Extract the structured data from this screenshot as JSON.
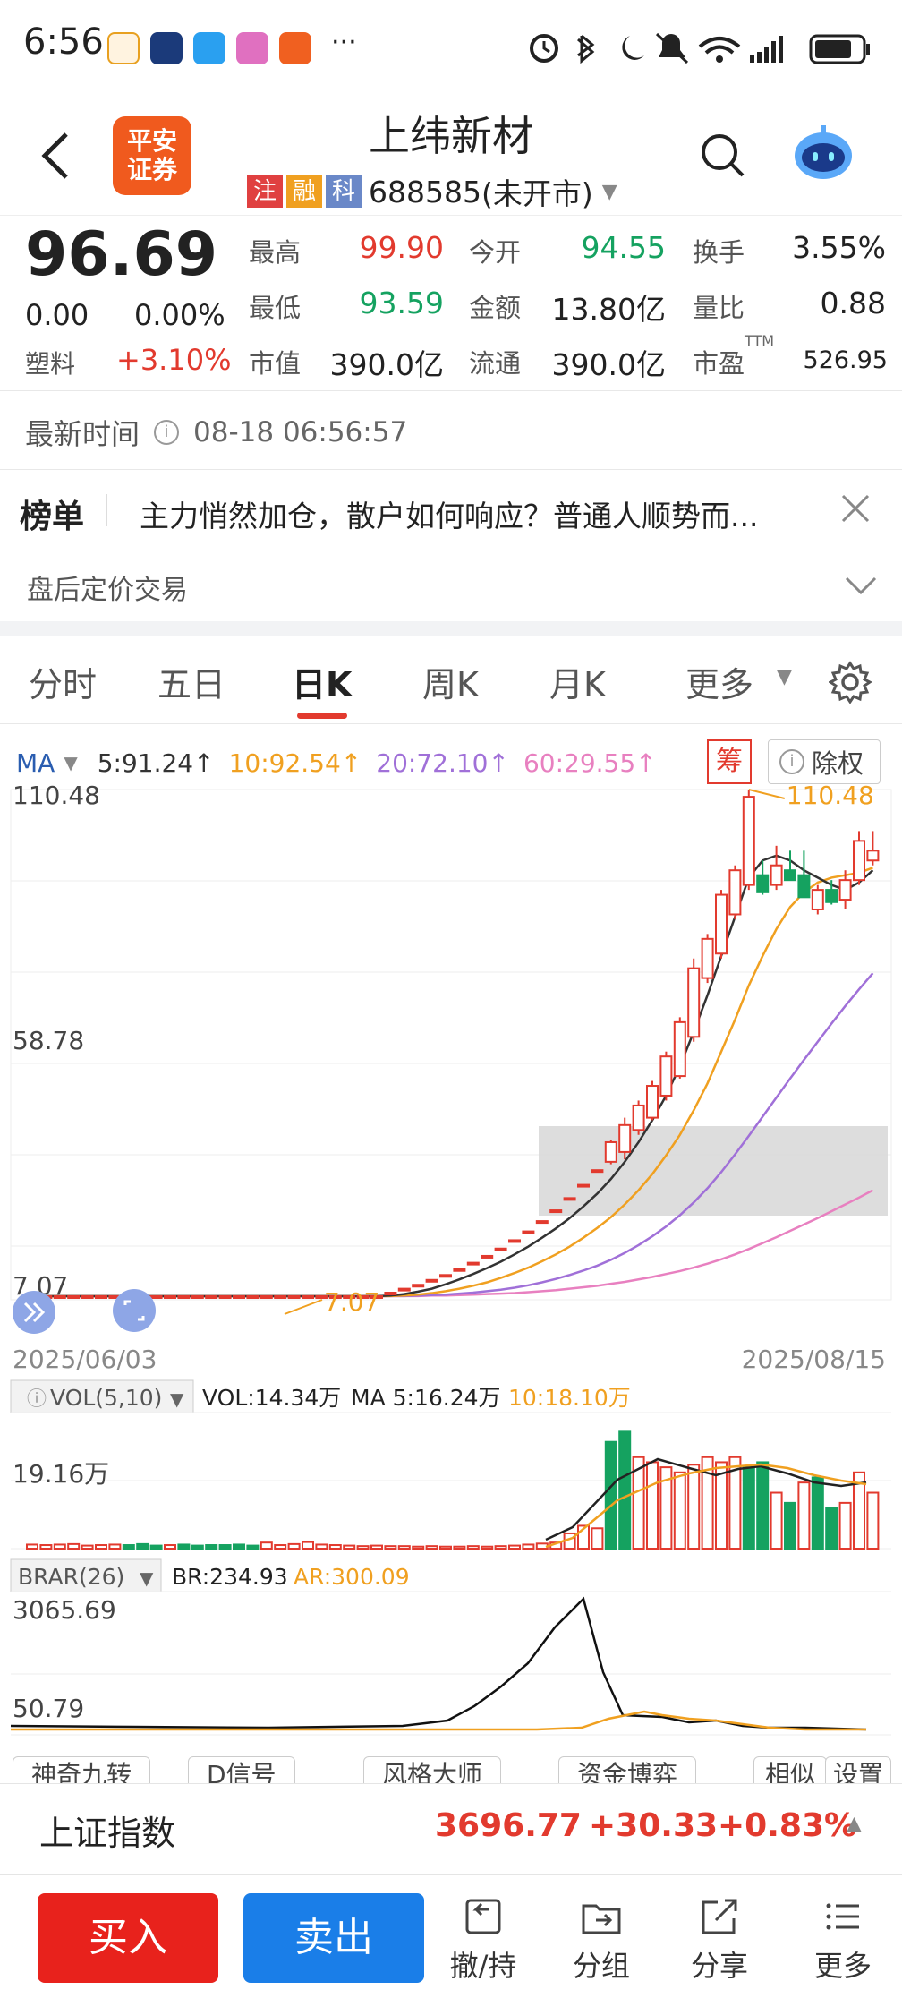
{
  "status_bar": {
    "time": "6:56"
  },
  "header": {
    "logo_line1": "平安",
    "logo_line2": "证券",
    "stock_name": "上纬新材",
    "tags": [
      "注",
      "融",
      "科"
    ],
    "code": "688585",
    "market_status": "(未开市)"
  },
  "quote": {
    "price": "96.69",
    "change": "0.00",
    "change_pct": "0.00%",
    "sector_name": "塑料",
    "sector_change": "+3.10%",
    "fields": {
      "high_label": "最高",
      "high": "99.90",
      "open_label": "今开",
      "open": "94.55",
      "turnover_label": "换手",
      "turnover": "3.55%",
      "low_label": "最低",
      "low": "93.59",
      "amount_label": "金额",
      "amount": "13.80亿",
      "volratio_label": "量比",
      "volratio": "0.88",
      "mktcap_label": "市值",
      "mktcap": "390.0亿",
      "float_label": "流通",
      "float": "390.0亿",
      "pe_label": "市盈",
      "pe_sup": "TTM",
      "pe": "526.95"
    }
  },
  "latest_time": {
    "label": "最新时间",
    "value": "08-18 06:56:57"
  },
  "ranking": {
    "label": "榜单",
    "headline": "主力悄然加仓，散户如何响应？普通人顺势而..."
  },
  "after_hours": {
    "label": "盘后定价交易"
  },
  "tabs": [
    "分时",
    "五日",
    "日K",
    "周K",
    "月K",
    "更多"
  ],
  "active_tab": "日K",
  "ma_bar": {
    "label": "MA",
    "ma5": "5:91.24↑",
    "ma10": "10:92.54↑",
    "ma20": "20:72.10↑",
    "ma60": "60:29.55↑",
    "chip_label": "筹",
    "adjust_label": "除权"
  },
  "colors": {
    "up": "#e23a2e",
    "down": "#15a260",
    "ma5": "#333333",
    "ma10": "#f0a020",
    "ma20": "#a070d8",
    "ma60": "#e880c0",
    "buy": "#e8221c",
    "sell": "#1a7ee8"
  },
  "chart_data": {
    "type": "candlestick",
    "ylim": [
      7.07,
      110.48
    ],
    "y_ticks": [
      "110.48",
      "58.78",
      "7.07"
    ],
    "max_label": "110.48",
    "min_label": "7.07",
    "start_date": "2025/06/03",
    "end_date": "2025/08/15",
    "candles": [
      [
        7.07,
        7.07,
        7.07,
        7.07
      ],
      [
        7.07,
        7.07,
        7.07,
        7.07
      ],
      [
        7.07,
        7.07,
        7.07,
        7.07
      ],
      [
        7.07,
        7.07,
        7.07,
        7.07
      ],
      [
        7.07,
        7.07,
        7.07,
        7.07
      ],
      [
        7.07,
        7.07,
        7.07,
        7.07
      ],
      [
        7.07,
        7.07,
        7.07,
        7.07
      ],
      [
        7.07,
        7.07,
        7.07,
        7.07
      ],
      [
        7.07,
        7.07,
        7.07,
        7.07
      ],
      [
        7.07,
        7.07,
        7.07,
        7.07
      ],
      [
        7.07,
        7.07,
        7.07,
        7.07
      ],
      [
        7.07,
        7.07,
        7.07,
        7.07
      ],
      [
        7.07,
        7.07,
        7.07,
        7.07
      ],
      [
        7.07,
        7.07,
        7.07,
        7.07
      ],
      [
        7.07,
        7.07,
        7.07,
        7.07
      ],
      [
        7.07,
        7.07,
        7.07,
        7.07
      ],
      [
        7.07,
        7.07,
        7.07,
        7.07
      ],
      [
        7.07,
        7.07,
        7.07,
        7.07
      ],
      [
        7.07,
        7.07,
        7.07,
        7.07
      ],
      [
        7.07,
        7.07,
        7.07,
        7.07
      ],
      [
        7.07,
        7.07,
        7.07,
        7.07
      ],
      [
        7.07,
        7.07,
        7.07,
        7.07
      ],
      [
        7.07,
        7.07,
        7.07,
        7.07
      ],
      [
        7.07,
        7.07,
        7.07,
        7.07
      ],
      [
        7.07,
        7.07,
        7.07,
        7.07
      ],
      [
        7.07,
        7.07,
        7.07,
        7.07
      ],
      [
        7.8,
        7.8,
        7.8,
        7.8
      ],
      [
        8.6,
        8.6,
        8.6,
        8.6
      ],
      [
        9.4,
        9.4,
        9.4,
        9.4
      ],
      [
        10.4,
        10.4,
        10.4,
        10.4
      ],
      [
        11.4,
        11.4,
        11.4,
        11.4
      ],
      [
        12.6,
        12.6,
        12.6,
        12.6
      ],
      [
        13.9,
        13.9,
        13.9,
        13.9
      ],
      [
        15.3,
        15.3,
        15.3,
        15.3
      ],
      [
        16.8,
        16.8,
        16.8,
        16.8
      ],
      [
        18.5,
        18.5,
        18.5,
        18.5
      ],
      [
        20.3,
        20.3,
        20.3,
        20.3
      ],
      [
        22.4,
        22.4,
        22.4,
        22.4
      ],
      [
        24.6,
        24.6,
        24.6,
        24.6
      ],
      [
        27.1,
        27.1,
        27.1,
        27.1
      ],
      [
        29.8,
        29.8,
        29.8,
        29.8
      ],
      [
        32.8,
        32.8,
        32.8,
        32.8
      ],
      [
        34.5,
        39.0,
        34.0,
        38.5
      ],
      [
        36.5,
        43.5,
        35.0,
        42.0
      ],
      [
        41.0,
        47.0,
        40.0,
        46.0
      ],
      [
        43.5,
        51.0,
        43.0,
        50.0
      ],
      [
        48.0,
        57.0,
        47.0,
        56.0
      ],
      [
        52.0,
        64.0,
        51.5,
        63.0
      ],
      [
        60.0,
        76.0,
        59.0,
        74.0
      ],
      [
        72.0,
        81.0,
        71.0,
        80.0
      ],
      [
        77.0,
        90.0,
        76.0,
        89.0
      ],
      [
        85.0,
        95.0,
        84.0,
        94.0
      ],
      [
        91.0,
        110.48,
        90.0,
        109.0
      ],
      [
        93.0,
        96.0,
        89.0,
        89.5
      ],
      [
        91.0,
        99.0,
        90.0,
        95.0
      ],
      [
        94.0,
        98.0,
        92.0,
        92.0
      ],
      [
        93.0,
        98.0,
        90.5,
        88.5
      ],
      [
        86.0,
        91.0,
        85.0,
        90.0
      ],
      [
        90.0,
        92.0,
        87.0,
        87.5
      ],
      [
        88.0,
        94.0,
        86.0,
        92.0
      ],
      [
        92.0,
        102.0,
        91.0,
        100.0
      ],
      [
        96.0,
        102.0,
        95.0,
        98.0
      ]
    ],
    "ma5": [
      7.07,
      7.07,
      7.07,
      7.07,
      7.07,
      7.07,
      7.07,
      7.07,
      7.07,
      7.07,
      7.07,
      7.07,
      7.07,
      7.07,
      7.07,
      7.07,
      7.07,
      7.07,
      7.07,
      7.07,
      7.07,
      7.07,
      7.07,
      7.07,
      7.07,
      7.07,
      7.2,
      7.5,
      8.0,
      8.6,
      9.5,
      10.5,
      11.6,
      12.8,
      14.1,
      15.6,
      17.2,
      19.0,
      20.9,
      23.0,
      25.4,
      28.0,
      31.0,
      34.5,
      38.5,
      43.0,
      48.0,
      54.0,
      61.0,
      68.5,
      76.5,
      84.5,
      92.5,
      96.0,
      97.0,
      96.0,
      94.0,
      92.5,
      91.0,
      90.0,
      91.5,
      94.0
    ],
    "ma10": [
      7.07,
      7.07,
      7.07,
      7.07,
      7.07,
      7.07,
      7.07,
      7.07,
      7.07,
      7.07,
      7.07,
      7.07,
      7.07,
      7.07,
      7.07,
      7.07,
      7.07,
      7.07,
      7.07,
      7.07,
      7.07,
      7.07,
      7.07,
      7.07,
      7.07,
      7.07,
      7.1,
      7.2,
      7.4,
      7.7,
      8.1,
      8.6,
      9.2,
      9.9,
      10.8,
      11.8,
      12.9,
      14.2,
      15.6,
      17.2,
      19.0,
      21.0,
      23.2,
      25.8,
      28.7,
      32.0,
      35.8,
      40.0,
      45.0,
      50.5,
      57.0,
      63.5,
      70.5,
      76.5,
      82.0,
      86.5,
      89.5,
      91.5,
      92.5,
      93.0,
      93.5,
      94.5
    ],
    "ma20": [
      7.07,
      7.07,
      7.07,
      7.07,
      7.07,
      7.07,
      7.07,
      7.07,
      7.07,
      7.07,
      7.07,
      7.07,
      7.07,
      7.07,
      7.07,
      7.07,
      7.07,
      7.07,
      7.07,
      7.07,
      7.07,
      7.07,
      7.07,
      7.07,
      7.07,
      7.07,
      7.1,
      7.1,
      7.2,
      7.3,
      7.4,
      7.6,
      7.8,
      8.1,
      8.4,
      8.8,
      9.3,
      9.9,
      10.6,
      11.4,
      12.3,
      13.3,
      14.5,
      15.9,
      17.5,
      19.3,
      21.3,
      23.6,
      26.2,
      29.1,
      32.4,
      36.0,
      39.8,
      43.7,
      47.6,
      51.5,
      55.3,
      59.0,
      62.7,
      66.3,
      69.7,
      73.0
    ],
    "ma60": [
      7.07,
      7.07,
      7.07,
      7.07,
      7.07,
      7.07,
      7.07,
      7.07,
      7.07,
      7.07,
      7.07,
      7.07,
      7.07,
      7.07,
      7.07,
      7.07,
      7.07,
      7.07,
      7.07,
      7.07,
      7.07,
      7.07,
      7.07,
      7.07,
      7.07,
      7.07,
      7.1,
      7.1,
      7.1,
      7.2,
      7.2,
      7.3,
      7.4,
      7.5,
      7.6,
      7.7,
      7.9,
      8.1,
      8.3,
      8.6,
      8.9,
      9.2,
      9.6,
      10.0,
      10.5,
      11.0,
      11.6,
      12.2,
      12.9,
      13.7,
      14.6,
      15.6,
      16.7,
      17.9,
      19.1,
      20.4,
      21.7,
      23.0,
      24.4,
      25.8,
      27.2,
      28.7
    ]
  },
  "vol_bar": {
    "label": "VOL(5,10)",
    "vol": "VOL:14.34万",
    "ma5": "MA 5:16.24万",
    "ma10": "10:18.10万",
    "tick": "19.16万"
  },
  "vol_data": {
    "max": 25,
    "values": [
      0.8,
      0.7,
      0.8,
      0.9,
      0.6,
      0.7,
      0.8,
      0.7,
      0.9,
      0.6,
      0.7,
      0.8,
      0.6,
      0.7,
      0.7,
      0.8,
      0.6,
      1.2,
      0.7,
      0.9,
      1.3,
      0.8,
      0.7,
      0.6,
      0.5,
      0.6,
      0.5,
      0.5,
      0.4,
      0.5,
      0.4,
      0.4,
      0.5,
      0.4,
      0.5,
      0.6,
      0.8,
      1.0,
      1.2,
      3.0,
      4.5,
      4.0,
      21.0,
      23.0,
      18.0,
      17.0,
      16.0,
      15.0,
      16.5,
      18.0,
      17.0,
      18.0,
      16.0,
      17.0,
      11.0,
      9.0,
      13.0,
      14.0,
      8.0,
      9.0,
      15.0,
      11.0
    ],
    "down": [
      7,
      8,
      9,
      11,
      12,
      13,
      14,
      15,
      16,
      42,
      43,
      52,
      53,
      55,
      57,
      58
    ]
  },
  "brar_bar": {
    "label": "BRAR(26)",
    "br": "BR:234.93",
    "ar": "AR:300.09",
    "tick_top": "3065.69",
    "tick_bottom": "50.79"
  },
  "indicator_pills": [
    "神奇九转",
    "D信号",
    "风格大师",
    "资金博弈",
    "相似",
    "设置"
  ],
  "index_bar": {
    "name": "上证指数",
    "value": "3696.77",
    "change": "+30.33",
    "change_pct": "+0.83%"
  },
  "bottom_bar": {
    "buy": "买入",
    "sell": "卖出",
    "items": [
      "撤/持",
      "分组",
      "分享",
      "更多"
    ]
  }
}
